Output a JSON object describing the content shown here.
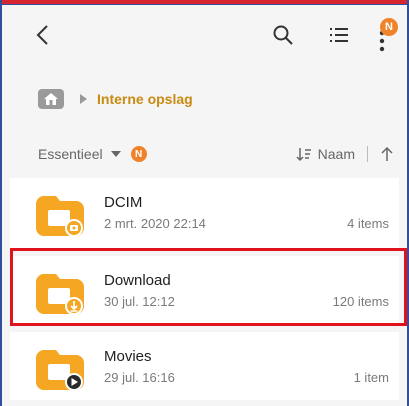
{
  "toolbar": {
    "back_icon": "chevron-left-icon",
    "search_icon": "search-icon",
    "list_icon": "list-view-icon",
    "more_icon": "more-vertical-icon",
    "more_badge": "N"
  },
  "breadcrumb": {
    "home_icon": "home-icon",
    "label": "Interne opslag"
  },
  "sortbar": {
    "filter_label": "Essentieel",
    "filter_badge": "N",
    "sort_label": "Naam"
  },
  "items": [
    {
      "name": "DCIM",
      "date": "2 mrt. 2020 22:14",
      "count": "4 items",
      "overlay_icon": "camera-icon"
    },
    {
      "name": "Download",
      "date": "30 jul. 12:12",
      "count": "120 items",
      "overlay_icon": "download-icon"
    },
    {
      "name": "Movies",
      "date": "29 jul. 16:16",
      "count": "1 item",
      "overlay_icon": "play-icon"
    }
  ],
  "colors": {
    "folder": "#f5a623",
    "accent": "#c98a12",
    "badge": "#f0832a",
    "highlight": "#e0121e"
  }
}
